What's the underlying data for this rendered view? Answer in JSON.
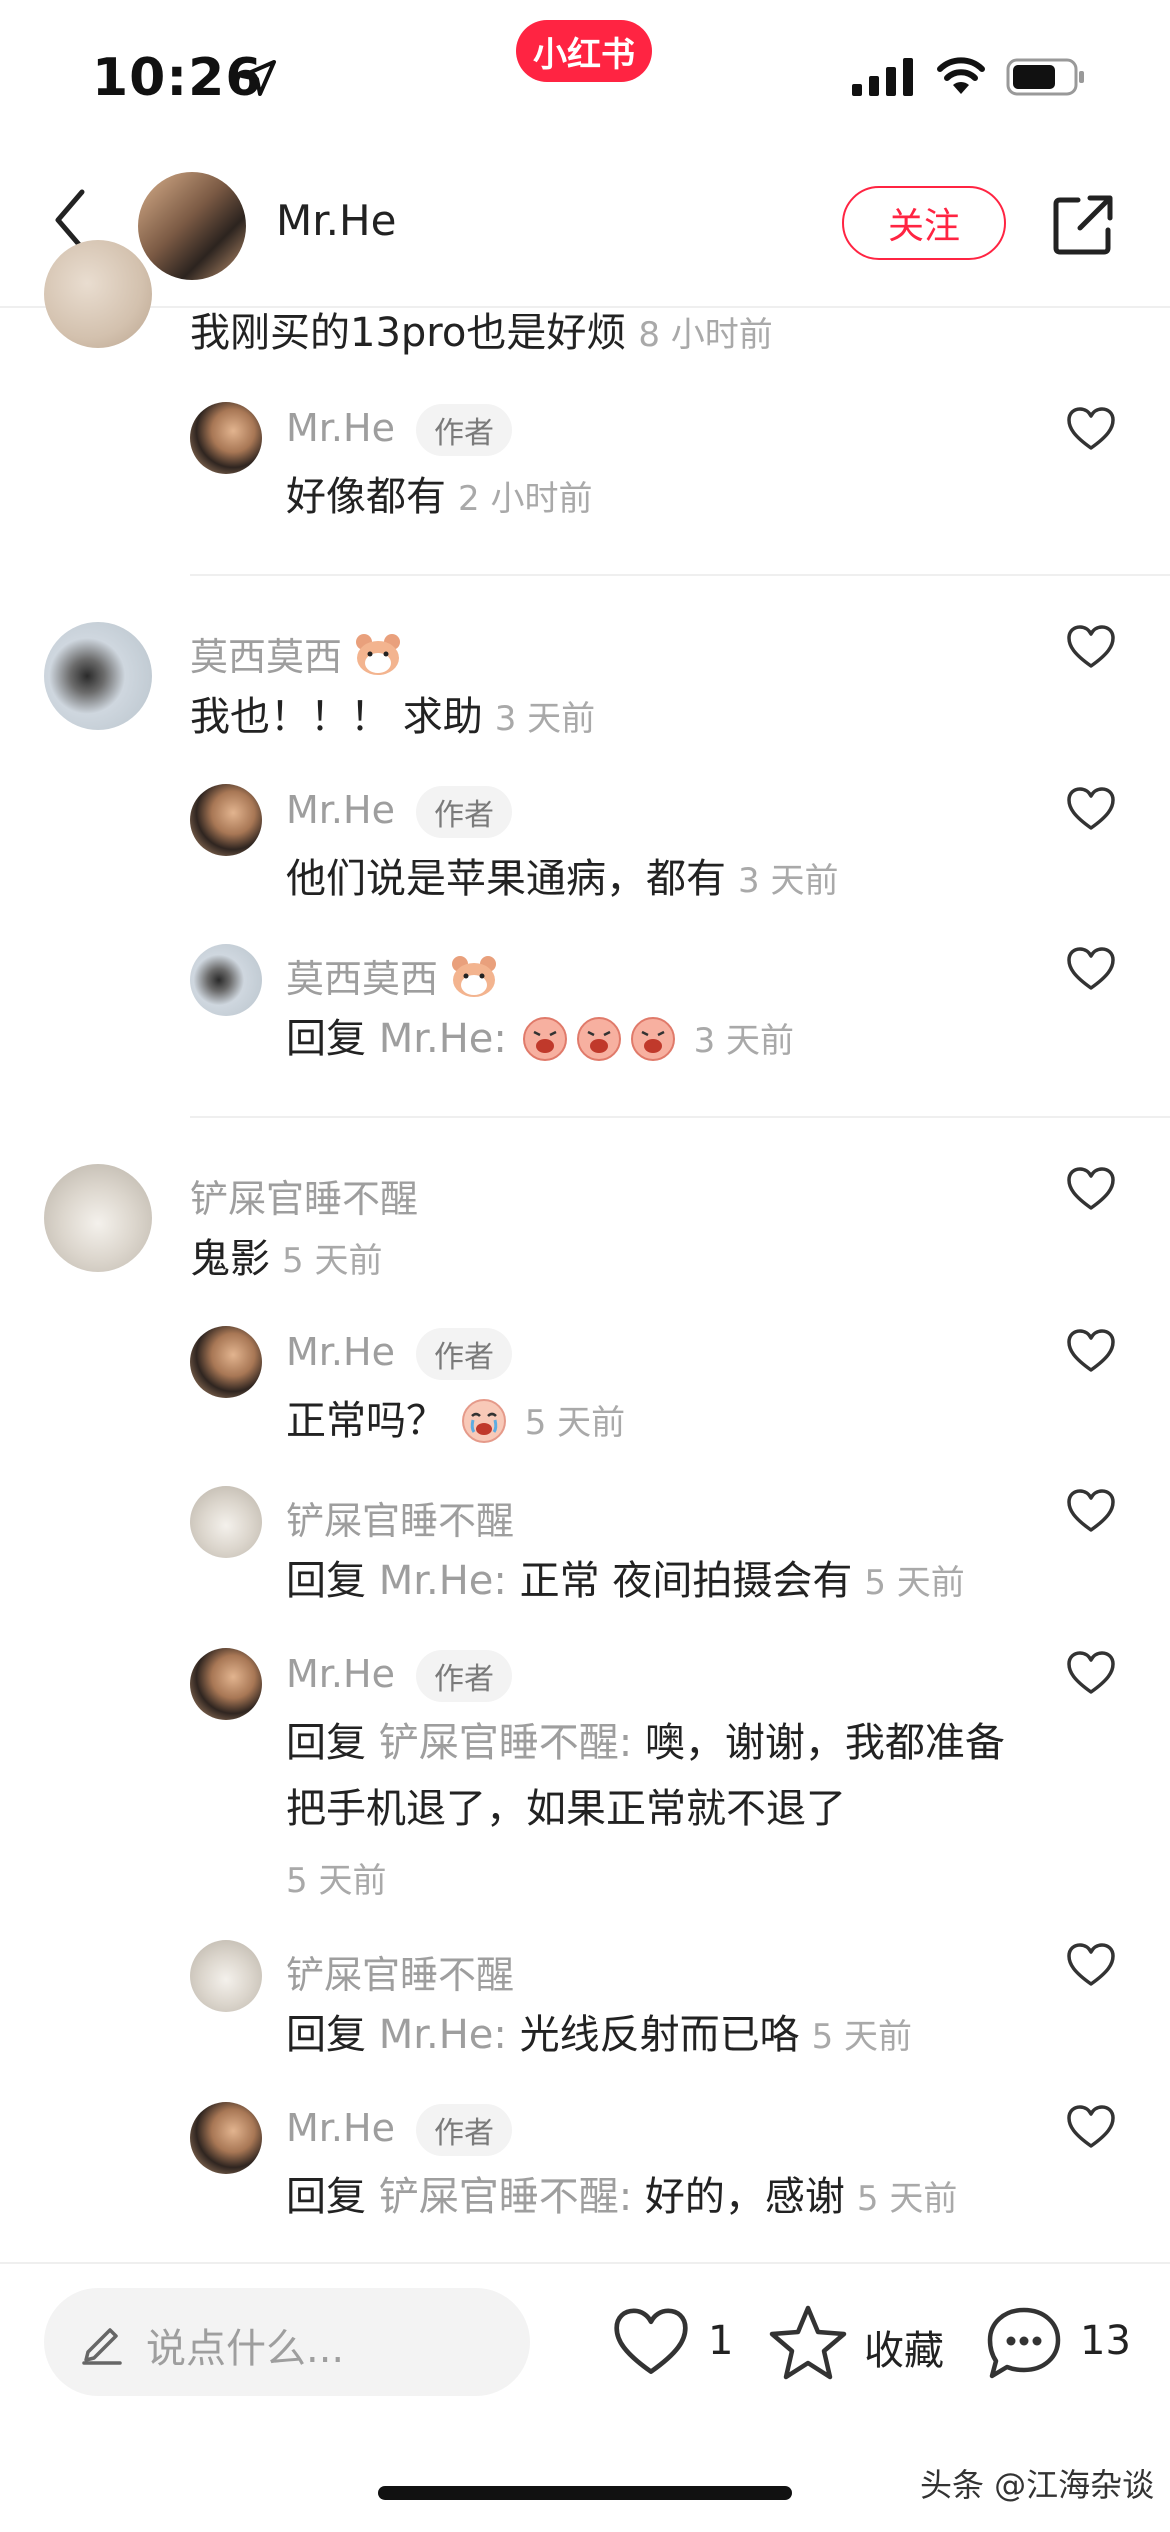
{
  "status_bar": {
    "time": "10:26",
    "app_badge": "小红书"
  },
  "header": {
    "author": "Mr.He",
    "follow_label": "关注"
  },
  "author_tag": "作者",
  "reply_prefix": "回复 ",
  "comments": [
    {
      "text": "我刚买的13pro也是好烦",
      "time": "8 小时前",
      "replies": [
        {
          "user": "Mr.He",
          "text": "好像都有",
          "time": "2 小时前"
        }
      ]
    },
    {
      "user": "莫西莫西",
      "text": "我也！！！ 求助",
      "time": "3 天前",
      "replies": [
        {
          "user": "Mr.He",
          "text": "他们说是苹果通病，都有",
          "time": "3 天前"
        },
        {
          "user": "莫西莫西",
          "reply_to": "Mr.He:",
          "time": "3 天前"
        }
      ]
    },
    {
      "user": "铲屎官睡不醒",
      "text": "鬼影",
      "time": "5 天前",
      "replies": [
        {
          "user": "Mr.He",
          "text": "正常吗？",
          "time": "5 天前"
        },
        {
          "user": "铲屎官睡不醒",
          "reply_to": "Mr.He:",
          "text": " 正常 夜间拍摄会有",
          "time": "5 天前"
        },
        {
          "user": "Mr.He",
          "reply_to": "铲屎官睡不醒:",
          "text": " 噢，谢谢，我都准备把手机退了，如果正常就不退了",
          "time": "5 天前"
        },
        {
          "user": "铲屎官睡不醒",
          "reply_to": "Mr.He:",
          "text": " 光线反射而已咯",
          "time": "5 天前"
        },
        {
          "user": "Mr.He",
          "reply_to": "铲屎官睡不醒:",
          "text": " 好的，感谢",
          "time": "5 天前"
        }
      ]
    }
  ],
  "bottom_bar": {
    "input_placeholder": "说点什么...",
    "like_count": "1",
    "collect_label": "收藏",
    "comment_count": "13"
  },
  "watermark": "头条 @江海杂谈",
  "colors": {
    "brand": "#ff2442",
    "muted_text": "#9e9e9e"
  }
}
